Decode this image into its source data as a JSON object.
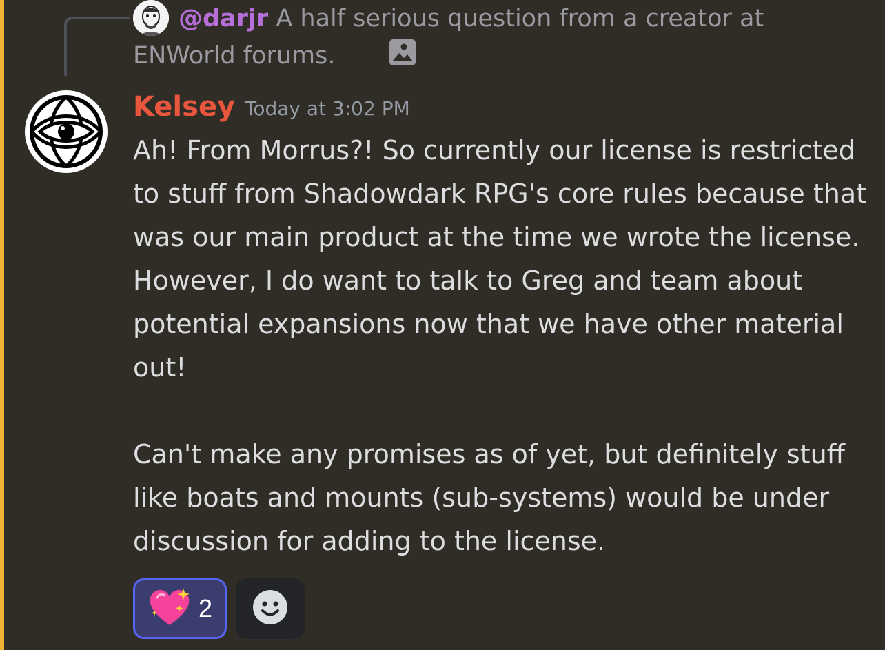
{
  "reply": {
    "author": "@darjr",
    "text": "A half serious question from a creator at ENWorld forums.",
    "attachment_icon": "image-icon"
  },
  "message": {
    "author": "Kelsey",
    "timestamp": "Today at 3:02 PM",
    "paragraphs": [
      "Ah! From Morrus?! So currently our license is restricted to stuff from Shadowdark RPG's core rules because that was our main product at the time we wrote the license. However, I do want to talk to Greg and team about potential expansions now that we have other material out!",
      "Can't make any promises as of yet, but definitely stuff like boats and mounts (sub-systems) would be under discussion for adding to the license."
    ]
  },
  "reactions": [
    {
      "emoji_icon": "sparkling-heart-icon",
      "count": "2"
    }
  ],
  "add_reaction_icon": "smiley-icon",
  "colors": {
    "background": "#302d27",
    "highlight_bar": "#f0b232",
    "reply_author": "#b66fd8",
    "author": "#e8563e",
    "reaction_border": "#5865f2",
    "reaction_bg": "#3b3d6e"
  }
}
